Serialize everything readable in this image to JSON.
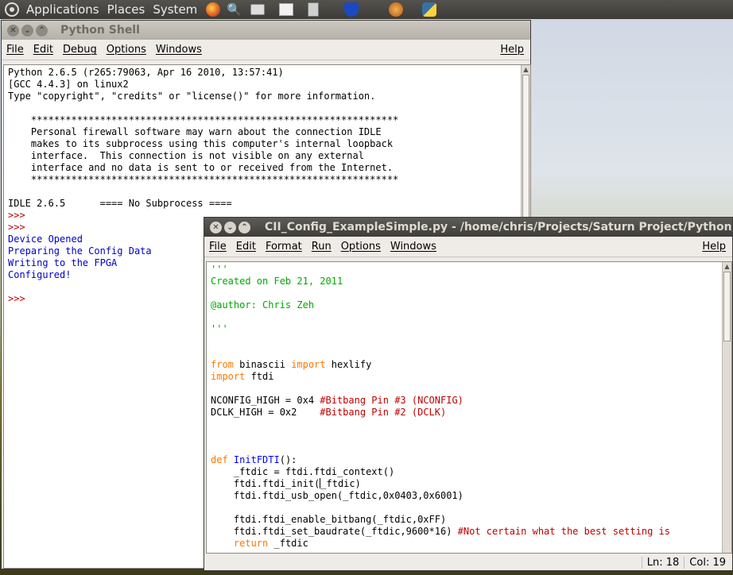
{
  "panel": {
    "menus": [
      "Applications",
      "Places",
      "System"
    ],
    "launchers": [
      "firefox-icon",
      "search-icon",
      "camera-icon",
      "image-viewer-icon",
      "calculator-icon",
      "shield-icon",
      "snail-icon",
      "python-icon"
    ]
  },
  "shell": {
    "title": "Python Shell",
    "menus": [
      "File",
      "Edit",
      "Debug",
      "Options",
      "Windows"
    ],
    "help": "Help",
    "lines": [
      {
        "text": "Python 2.6.5 (r265:79063, Apr 16 2010, 13:57:41)",
        "color": "black"
      },
      {
        "text": "[GCC 4.4.3] on linux2",
        "color": "black"
      },
      {
        "text": "Type \"copyright\", \"credits\" or \"license()\" for more information.",
        "color": "black"
      },
      {
        "text": "",
        "color": "black"
      },
      {
        "text": "    ****************************************************************",
        "color": "black"
      },
      {
        "text": "    Personal firewall software may warn about the connection IDLE",
        "color": "black"
      },
      {
        "text": "    makes to its subprocess using this computer's internal loopback",
        "color": "black"
      },
      {
        "text": "    interface.  This connection is not visible on any external",
        "color": "black"
      },
      {
        "text": "    interface and no data is sent to or received from the Internet.",
        "color": "black"
      },
      {
        "text": "    ****************************************************************",
        "color": "black"
      },
      {
        "text": "",
        "color": "black"
      },
      {
        "text": "IDLE 2.6.5      ==== No Subprocess ====",
        "color": "black"
      },
      {
        "text": ">>>",
        "color": "red"
      },
      {
        "text": ">>>",
        "color": "red"
      },
      {
        "text": "Device Opened",
        "color": "blue"
      },
      {
        "text": "Preparing the Config Data",
        "color": "blue"
      },
      {
        "text": "Writing to the FPGA",
        "color": "blue"
      },
      {
        "text": "Configured!",
        "color": "blue"
      },
      {
        "text": "",
        "color": "black"
      },
      {
        "text": ">>>",
        "color": "red"
      }
    ]
  },
  "editor": {
    "title": "CII_Config_ExampleSimple.py - /home/chris/Projects/Saturn Project/Python/C",
    "menus": [
      "File",
      "Edit",
      "Format",
      "Run",
      "Options",
      "Windows"
    ],
    "help": "Help",
    "status_line": "Ln: 18",
    "status_col": "Col: 19",
    "lines": [
      [
        {
          "t": "'''",
          "c": "green"
        }
      ],
      [
        {
          "t": "Created on Feb 21, 2011",
          "c": "green"
        }
      ],
      [
        {
          "t": "",
          "c": "black"
        }
      ],
      [
        {
          "t": "@author: Chris Zeh",
          "c": "green"
        }
      ],
      [
        {
          "t": "",
          "c": "black"
        }
      ],
      [
        {
          "t": "'''",
          "c": "green"
        }
      ],
      [
        {
          "t": "",
          "c": "black"
        }
      ],
      [
        {
          "t": "",
          "c": "black"
        }
      ],
      [
        {
          "t": "from",
          "c": "orange"
        },
        {
          "t": " binascii ",
          "c": "black"
        },
        {
          "t": "import",
          "c": "orange"
        },
        {
          "t": " hexlify",
          "c": "black"
        }
      ],
      [
        {
          "t": "import",
          "c": "orange"
        },
        {
          "t": " ftdi",
          "c": "black"
        }
      ],
      [
        {
          "t": "",
          "c": "black"
        }
      ],
      [
        {
          "t": "NCONFIG_HIGH = 0x4 ",
          "c": "black"
        },
        {
          "t": "#Bitbang Pin #3 (NCONFIG)",
          "c": "red"
        }
      ],
      [
        {
          "t": "DCLK_HIGH = 0x2    ",
          "c": "black"
        },
        {
          "t": "#Bitbang Pin #2 (DCLK)",
          "c": "red"
        }
      ],
      [
        {
          "t": "",
          "c": "black"
        }
      ],
      [
        {
          "t": "",
          "c": "black"
        }
      ],
      [
        {
          "t": "",
          "c": "black"
        }
      ],
      [
        {
          "t": "def",
          "c": "orange"
        },
        {
          "t": " ",
          "c": "black"
        },
        {
          "t": "InitFDTI",
          "c": "defname"
        },
        {
          "t": "():",
          "c": "black"
        }
      ],
      [
        {
          "t": "    _ftdic = ftdi.ftdi_context()",
          "c": "black"
        }
      ],
      [
        {
          "t": "    ftdi.ftdi_init(",
          "c": "black"
        },
        {
          "t": "CURSOR",
          "c": "cursor"
        },
        {
          "t": "_ftdic)",
          "c": "black"
        }
      ],
      [
        {
          "t": "    ftdi.ftdi_usb_open(_ftdic,0x0403,0x6001)",
          "c": "black"
        }
      ],
      [
        {
          "t": "",
          "c": "black"
        }
      ],
      [
        {
          "t": "    ftdi.ftdi_enable_bitbang(_ftdic,0xFF)",
          "c": "black"
        }
      ],
      [
        {
          "t": "    ftdi.ftdi_set_baudrate(_ftdic,9600*16) ",
          "c": "black"
        },
        {
          "t": "#Not certain what the best setting is",
          "c": "red"
        }
      ],
      [
        {
          "t": "    ",
          "c": "black"
        },
        {
          "t": "return",
          "c": "orange"
        },
        {
          "t": " _ftdic",
          "c": "black"
        }
      ]
    ]
  }
}
